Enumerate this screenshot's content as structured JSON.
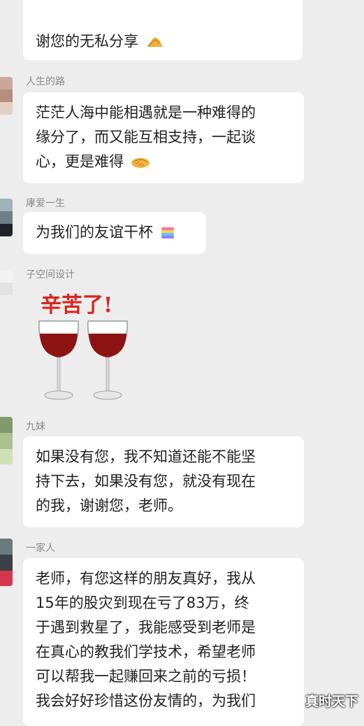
{
  "messages": [
    {
      "sender": "",
      "lines": [
        "谢您的无私分享"
      ],
      "emoji": "ok-hand-emoji"
    },
    {
      "sender": "人生的路",
      "lines": [
        "茫茫人海中能相遇就是一种难得的",
        "缘分了，而又能互相支持，一起谈",
        "心，更是难得"
      ],
      "emoji": "handshake-emoji"
    },
    {
      "sender": "庨爱一生",
      "lines": [
        "为我们的友谊干杯"
      ],
      "emoji": "rainbow-cake-emoji"
    },
    {
      "sender": "子空间设计",
      "sticker_text": "辛苦了!",
      "sticker_icon": "wine-glasses-sticker"
    },
    {
      "sender": "九妹",
      "lines": [
        "如果没有您，我不知道还能不能坚",
        "持下去，如果没有您，就没有现在",
        "的我，谢谢您，老师。"
      ]
    },
    {
      "sender": "一家人",
      "lines": [
        "老师，有您这样的朋友真好，我从",
        "15年的股灾到现在亏了83万，终",
        "于遇到救星了，我能感受到老师是",
        "在真心的教我们学技术，希望老师",
        "可以帮我一起赚回来之前的亏损！",
        "我会好好珍惜这份友情的，为我们"
      ]
    }
  ],
  "watermark": "真时天下",
  "colors": {
    "background": "#ededed",
    "bubble": "#ffffff",
    "nickname": "#8a8a8a",
    "sticker_text": "#d7261f",
    "wine": "#8e1414"
  }
}
